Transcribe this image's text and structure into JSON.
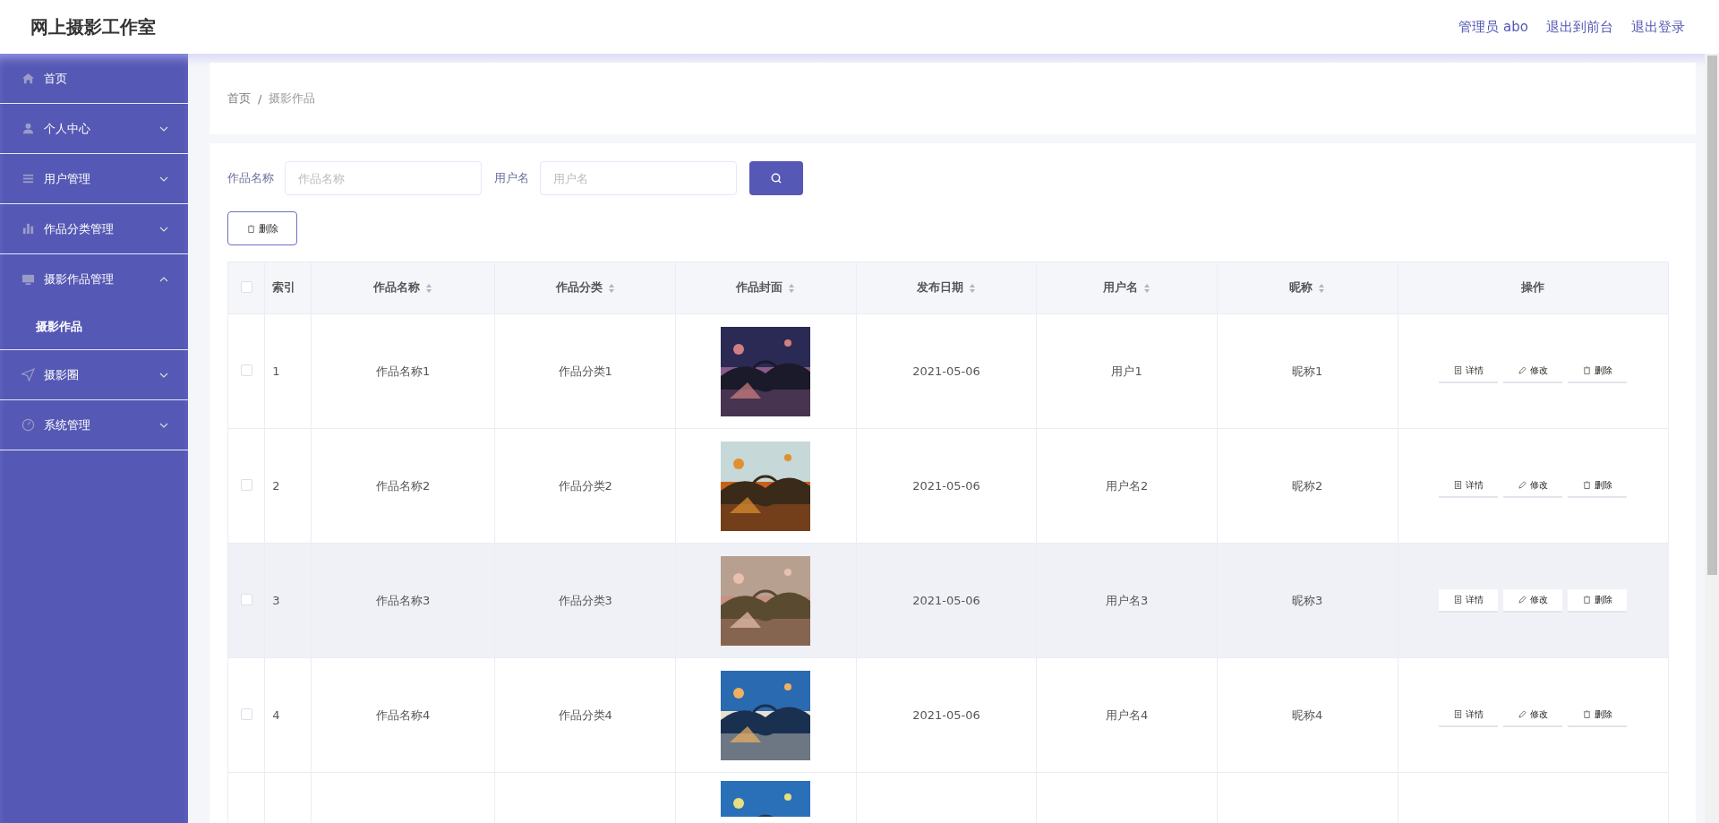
{
  "header": {
    "title": "网上摄影工作室",
    "links": [
      {
        "label": "管理员 abo"
      },
      {
        "label": "退出到前台"
      },
      {
        "label": "退出登录"
      }
    ]
  },
  "sidebar": {
    "items": [
      {
        "label": "首页"
      },
      {
        "label": "个人中心",
        "expanded": false
      },
      {
        "label": "用户管理",
        "expanded": false
      },
      {
        "label": "作品分类管理",
        "expanded": false
      },
      {
        "label": "摄影作品管理",
        "expanded": true,
        "children": [
          {
            "label": "摄影作品",
            "selected": true
          }
        ]
      },
      {
        "label": "摄影圈",
        "expanded": false
      },
      {
        "label": "系统管理",
        "expanded": false
      }
    ]
  },
  "breadcrumb": [
    "首页",
    "/",
    "摄影作品"
  ],
  "search": {
    "fields": [
      {
        "label": "作品名称",
        "placeholder": "作品名称"
      },
      {
        "label": "用户名",
        "placeholder": "用户名"
      }
    ]
  },
  "delete_button": {
    "label": "删除"
  },
  "table": {
    "select_all": {
      "checked": false
    },
    "columns": [
      {
        "label": "索引",
        "sortable": false
      },
      {
        "label": "作品名称",
        "sortable": true
      },
      {
        "label": "作品分类",
        "sortable": true
      },
      {
        "label": "作品封面",
        "sortable": true
      },
      {
        "label": "发布日期",
        "sortable": true
      },
      {
        "label": "用户名",
        "sortable": true
      },
      {
        "label": "昵称",
        "sortable": true
      },
      {
        "label": "操作",
        "sortable": false
      }
    ],
    "rows": [
      {
        "checked": false,
        "hovered": false,
        "index": "1",
        "name": "作品名称1",
        "category": "作品分类1",
        "cover": {
          "kind": "picture"
        },
        "date": "2021-05-06",
        "username": "用户1",
        "nickname": "昵称1",
        "actions": [
          {
            "kind": "detail",
            "label": "详情"
          },
          {
            "kind": "edit",
            "label": "修改"
          },
          {
            "kind": "delete",
            "label": "删除"
          }
        ]
      },
      {
        "checked": false,
        "hovered": false,
        "index": "2",
        "name": "作品名称2",
        "category": "作品分类2",
        "cover": {
          "kind": "picture"
        },
        "date": "2021-05-06",
        "username": "用户名2",
        "nickname": "昵称2",
        "actions": [
          {
            "kind": "detail",
            "label": "详情"
          },
          {
            "kind": "edit",
            "label": "修改"
          },
          {
            "kind": "delete",
            "label": "删除"
          }
        ]
      },
      {
        "checked": false,
        "hovered": true,
        "index": "3",
        "name": "作品名称3",
        "category": "作品分类3",
        "cover": {
          "kind": "picture"
        },
        "date": "2021-05-06",
        "username": "用户名3",
        "nickname": "昵称3",
        "actions": [
          {
            "kind": "detail",
            "label": "详情"
          },
          {
            "kind": "edit",
            "label": "修改"
          },
          {
            "kind": "delete",
            "label": "删除"
          }
        ]
      },
      {
        "checked": false,
        "hovered": false,
        "index": "4",
        "name": "作品名称4",
        "category": "作品分类4",
        "cover": {
          "kind": "picture"
        },
        "date": "2021-05-06",
        "username": "用户名4",
        "nickname": "昵称4",
        "actions": [
          {
            "kind": "detail",
            "label": "详情"
          },
          {
            "kind": "edit",
            "label": "修改"
          },
          {
            "kind": "delete",
            "label": "删除"
          }
        ]
      },
      {
        "cover": {
          "kind": "picture"
        }
      }
    ]
  }
}
